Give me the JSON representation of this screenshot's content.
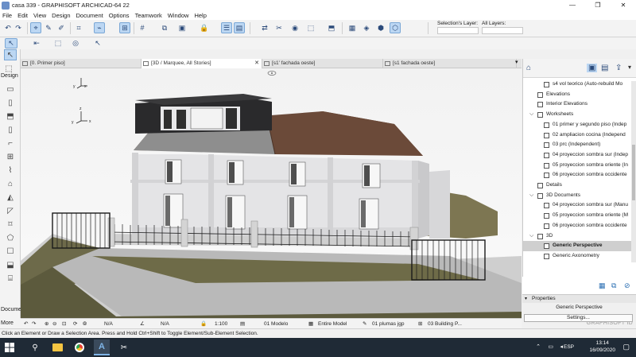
{
  "window": {
    "title": "casa 339 - GRAPHISOFT ARCHICAD-64 22",
    "controls": [
      "—",
      "❐",
      "✕"
    ]
  },
  "menu": [
    "File",
    "Edit",
    "View",
    "Design",
    "Document",
    "Options",
    "Teamwork",
    "Window",
    "Help"
  ],
  "toolbar": {
    "selection_layer_label": "Selection's Layer:",
    "all_layers_label": "All Layers:"
  },
  "toolbox": {
    "design_label": "Design",
    "document_label": "Docume",
    "more_label": "More"
  },
  "tabs": [
    {
      "label": "[0. Primer piso]",
      "active": false
    },
    {
      "label": "[3D / Marquee, All Stories]",
      "active": true
    },
    {
      "label": "[s1' fachada oeste]",
      "active": false
    },
    {
      "label": "[s1 fachada oeste]",
      "active": false
    }
  ],
  "navigator": {
    "items": [
      {
        "label": "s4 vol teorico (Auto-rebuild Mo",
        "indent": 2,
        "icon": "section-icon",
        "chevron": false
      },
      {
        "label": "Elevations",
        "indent": 1,
        "icon": "elevation-icon",
        "chevron": false
      },
      {
        "label": "Interior Elevations",
        "indent": 1,
        "icon": "interior-elevation-icon",
        "chevron": false
      },
      {
        "label": "Worksheets",
        "indent": 1,
        "icon": "worksheet-icon",
        "chevron": true
      },
      {
        "label": "01 primer y segundo piso (Indep",
        "indent": 2,
        "icon": "worksheet-icon",
        "chevron": false
      },
      {
        "label": "02 ampliacion cocina (Independ",
        "indent": 2,
        "icon": "worksheet-icon",
        "chevron": false
      },
      {
        "label": "03 prc (Independent)",
        "indent": 2,
        "icon": "worksheet-icon",
        "chevron": false
      },
      {
        "label": "04 proyeccion sombra sur (Indep",
        "indent": 2,
        "icon": "worksheet-icon",
        "chevron": false
      },
      {
        "label": "05 proyeccion sombra oriente (In",
        "indent": 2,
        "icon": "worksheet-icon",
        "chevron": false
      },
      {
        "label": "06 proyeccion sombra occidente",
        "indent": 2,
        "icon": "worksheet-icon",
        "chevron": false
      },
      {
        "label": "Details",
        "indent": 1,
        "icon": "detail-icon",
        "chevron": false
      },
      {
        "label": "3D Documents",
        "indent": 1,
        "icon": "3d-document-icon",
        "chevron": true
      },
      {
        "label": "04 proyeccion sombra sur (Manu",
        "indent": 2,
        "icon": "3d-document-icon",
        "chevron": false
      },
      {
        "label": "05 proyeccion sombra oriente (M",
        "indent": 2,
        "icon": "3d-document-icon",
        "chevron": false
      },
      {
        "label": "06 proyeccion sombra occidente",
        "indent": 2,
        "icon": "3d-document-icon",
        "chevron": false
      },
      {
        "label": "3D",
        "indent": 1,
        "icon": "3d-icon",
        "chevron": true
      },
      {
        "label": "Generic Perspective",
        "indent": 2,
        "icon": "perspective-icon",
        "chevron": false,
        "selected": true
      },
      {
        "label": "Generic Axonometry",
        "indent": 2,
        "icon": "axonometry-icon",
        "chevron": false
      }
    ]
  },
  "properties": {
    "header": "Properties",
    "name": "Generic Perspective",
    "settings_button": "Settings..."
  },
  "quickbar": {
    "na1": "N/A",
    "na2": "N/A",
    "scale": "1:100",
    "model": "01 Modelo",
    "entire_model": "Entire Model",
    "pen_set": "01 plumas jgp",
    "building": "03 Building P..."
  },
  "branding": "GRAPHISOFT ID",
  "status_message": "Click an Element or Draw a Selection Area. Press and Hold Ctrl+Shift to Toggle Element/Sub-Element Selection.",
  "taskbar": {
    "language": "ESP",
    "time": "13:14",
    "date": "16/09/2020"
  }
}
